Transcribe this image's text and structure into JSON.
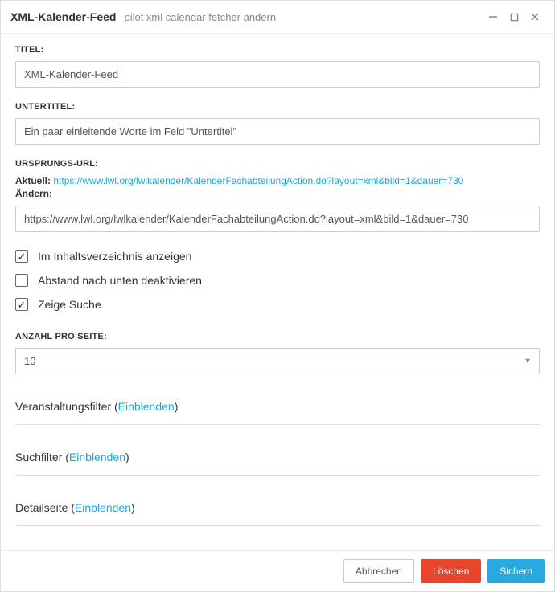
{
  "titlebar": {
    "title": "XML-Kalender-Feed",
    "subtitle": "pilot xml calendar fetcher ändern"
  },
  "labels": {
    "titel": "TITEL:",
    "untertitel": "UNTERTITEL:",
    "ursprungs_url": "URSPRUNGS-URL:",
    "aktuell": "Aktuell:",
    "aendern": "Ändern:",
    "anzahl_pro_seite": "ANZAHL PRO SEITE:"
  },
  "fields": {
    "titel_value": "XML-Kalender-Feed",
    "untertitel_value": "Ein paar einleitende Worte im Feld \"Untertitel\"",
    "url_current": "https://www.lwl.org/lwlkalender/KalenderFachabteilungAction.do?layout=xml&bild=1&dauer=730",
    "url_edit": "https://www.lwl.org/lwlkalender/KalenderFachabteilungAction.do?layout=xml&bild=1&dauer=730",
    "anzahl_pro_seite_value": "10"
  },
  "checkboxes": {
    "inhaltsverzeichnis": {
      "label": "Im Inhaltsverzeichnis anzeigen",
      "checked": true
    },
    "abstand": {
      "label": "Abstand nach unten deaktivieren",
      "checked": false
    },
    "suche": {
      "label": "Zeige Suche",
      "checked": true
    }
  },
  "sections": {
    "veranstaltungsfilter": {
      "prefix": "Veranstaltungsfilter (",
      "link": "Einblenden",
      "suffix": ")"
    },
    "suchfilter": {
      "prefix": "Suchfilter (",
      "link": "Einblenden",
      "suffix": ")"
    },
    "detailseite": {
      "prefix": "Detailseite (",
      "link": "Einblenden",
      "suffix": ")"
    }
  },
  "footer": {
    "cancel": "Abbrechen",
    "delete": "Löschen",
    "save": "Sichern"
  }
}
